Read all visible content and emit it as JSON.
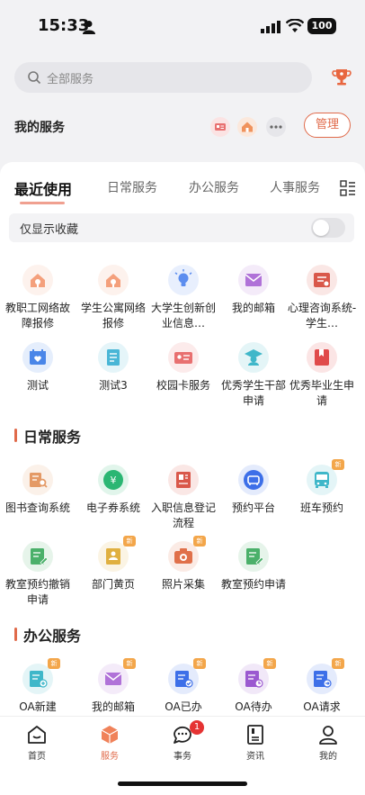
{
  "status_bar": {
    "time": "15:33",
    "battery": "100"
  },
  "search": {
    "placeholder": "全部服务"
  },
  "my_services": {
    "label": "我的服务",
    "manage_label": "管理"
  },
  "tabs": [
    {
      "label": "最近使用",
      "active": true
    },
    {
      "label": "日常服务",
      "active": false
    },
    {
      "label": "办公服务",
      "active": false
    },
    {
      "label": "人事服务",
      "active": false
    }
  ],
  "favorites_filter": {
    "label": "仅显示收藏",
    "enabled": false
  },
  "recent": {
    "items": [
      {
        "label": "教职工网络故障报修",
        "icon": "house-wrench-icon",
        "color": "#f4a07c"
      },
      {
        "label": "学生公寓网络报修",
        "icon": "house-wrench-icon",
        "color": "#f4a07c"
      },
      {
        "label": "大学生创新创业信息…",
        "icon": "lightbulb-icon",
        "color": "#5b8def"
      },
      {
        "label": "我的邮箱",
        "icon": "mail-icon",
        "color": "#b072d8"
      },
      {
        "label": "心理咨询系统-学生…",
        "icon": "counseling-icon",
        "color": "#d9584a"
      },
      {
        "label": "测试",
        "icon": "calendar-heart-icon",
        "color": "#4a86e8"
      },
      {
        "label": "测试3",
        "icon": "document-icon",
        "color": "#49b6d6"
      },
      {
        "label": "校园卡服务",
        "icon": "id-card-icon",
        "color": "#e87070"
      },
      {
        "label": "优秀学生干部申请",
        "icon": "graduate-icon",
        "color": "#3fb7c9"
      },
      {
        "label": "优秀毕业生申请",
        "icon": "book-icon",
        "color": "#e04a4a"
      }
    ]
  },
  "daily": {
    "title": "日常服务",
    "items": [
      {
        "label": "图书查询系统",
        "icon": "book-search-icon",
        "color": "#e49a66",
        "new": false
      },
      {
        "label": "电子券系统",
        "icon": "coupon-icon",
        "color": "#2bb673",
        "new": false
      },
      {
        "label": "入职信息登记流程",
        "icon": "id-form-icon",
        "color": "#d9584a",
        "new": false
      },
      {
        "label": "预约平台",
        "icon": "sofa-icon",
        "color": "#3d6fe8",
        "new": false
      },
      {
        "label": "班车预约",
        "icon": "bus-icon",
        "color": "#3fb7c9",
        "new": true
      },
      {
        "label": "教室预约撤销申请",
        "icon": "form-edit-icon",
        "color": "#4bb06a",
        "new": false
      },
      {
        "label": "部门黄页",
        "icon": "directory-icon",
        "color": "#e0b040",
        "new": true
      },
      {
        "label": "照片采集",
        "icon": "camera-icon",
        "color": "#e0704a",
        "new": true
      },
      {
        "label": "教室预约申请",
        "icon": "form-edit-icon",
        "color": "#4bb06a",
        "new": false
      }
    ]
  },
  "office": {
    "title": "办公服务",
    "items": [
      {
        "label": "OA新建",
        "icon": "oa-new-icon",
        "color": "#3fb7c9",
        "new": true
      },
      {
        "label": "我的邮箱",
        "icon": "mail-icon",
        "color": "#b072d8",
        "new": true
      },
      {
        "label": "OA已办",
        "icon": "oa-done-icon",
        "color": "#3d6fe8",
        "new": true
      },
      {
        "label": "OA待办",
        "icon": "oa-todo-icon",
        "color": "#9b59d0",
        "new": true
      },
      {
        "label": "OA请求",
        "icon": "oa-request-icon",
        "color": "#3d6fe8",
        "new": true
      }
    ]
  },
  "new_badge": "新",
  "tabbar": [
    {
      "label": "首页",
      "icon": "home-icon",
      "active": false
    },
    {
      "label": "服务",
      "icon": "service-cube-icon",
      "active": true
    },
    {
      "label": "事务",
      "icon": "chat-icon",
      "active": false,
      "badge": "1"
    },
    {
      "label": "资讯",
      "icon": "news-icon",
      "active": false
    },
    {
      "label": "我的",
      "icon": "profile-icon",
      "active": false
    }
  ],
  "colors": {
    "accent": "#e06a4a",
    "badge": "#e53333"
  }
}
